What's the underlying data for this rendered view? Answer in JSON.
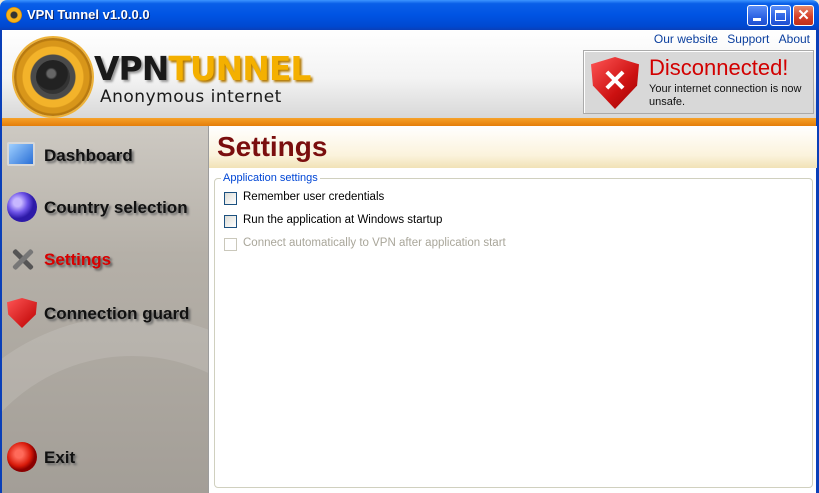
{
  "window": {
    "title": "VPN Tunnel v1.0.0.0",
    "controls": {
      "minimize": "",
      "maximize": "",
      "close": "✕"
    }
  },
  "brand": {
    "logo_vpn": "VPN",
    "logo_tunnel": "TUNNEL",
    "tagline": "Anonymous internet"
  },
  "top_links": [
    "Our website",
    "Support",
    "About"
  ],
  "status": {
    "title": "Disconnected!",
    "message": "Your internet connection is now unsafe.",
    "icon": "shield-x-icon",
    "color": "#d20000"
  },
  "sidebar": {
    "items": [
      {
        "label": "Dashboard",
        "icon": "monitor-icon",
        "active": false
      },
      {
        "label": "Country selection",
        "icon": "globe-icon",
        "active": false
      },
      {
        "label": "Settings",
        "icon": "tools-icon",
        "active": true
      },
      {
        "label": "Connection guard",
        "icon": "shield-icon",
        "active": false
      }
    ],
    "exit": {
      "label": "Exit",
      "icon": "exit-icon"
    }
  },
  "main": {
    "title": "Settings",
    "group_title": "Application settings",
    "options": [
      {
        "label": "Remember user credentials",
        "checked": false,
        "enabled": true
      },
      {
        "label": "Run the application at Windows startup",
        "checked": false,
        "enabled": true
      },
      {
        "label": "Connect automatically to VPN after application start",
        "checked": false,
        "enabled": false
      }
    ]
  },
  "colors": {
    "title_bar": "#0054e3",
    "accent_orange": "#e47e0a",
    "page_title": "#7a0e0e",
    "active_nav": "#d80000"
  }
}
